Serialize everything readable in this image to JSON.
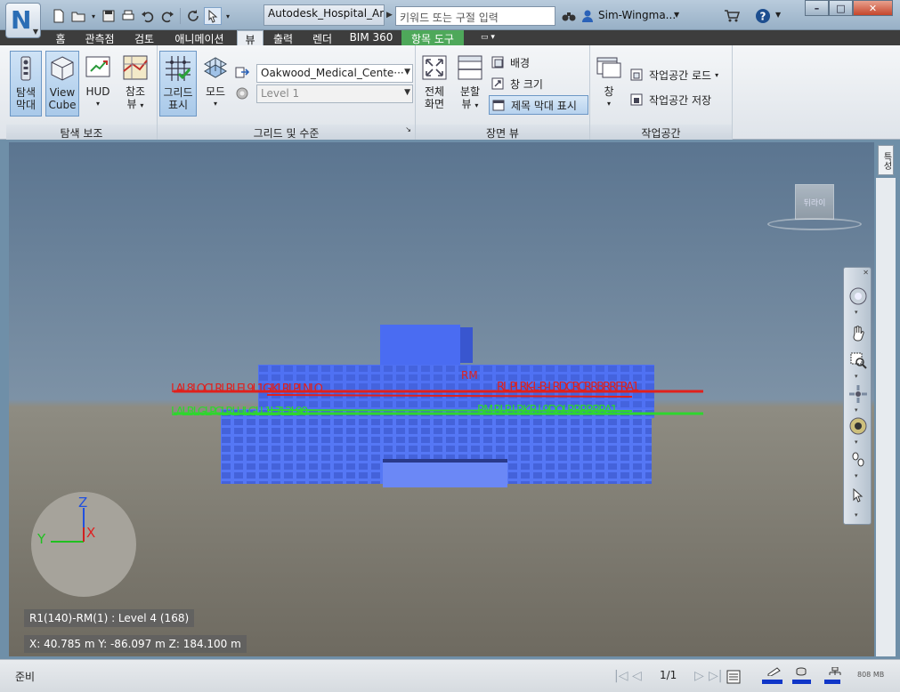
{
  "app": {
    "logo_letter": "N",
    "document_title": "Autodesk_Hospital_Ar...",
    "search_placeholder": "키워드 또는 구절 입력",
    "user_name": "Sim-Wingma...",
    "window_controls": {
      "minimize": "–",
      "maximize": "□",
      "close": "✕"
    }
  },
  "tabs": [
    {
      "label": "홈",
      "active": false
    },
    {
      "label": "관측점",
      "active": false
    },
    {
      "label": "검토",
      "active": false
    },
    {
      "label": "애니메이션",
      "active": false
    },
    {
      "label": "뷰",
      "active": true
    },
    {
      "label": "출력",
      "active": false
    },
    {
      "label": "렌더",
      "active": false
    },
    {
      "label": "BIM 360",
      "active": false
    },
    {
      "label": "항목 도구",
      "active": false,
      "contextual": true
    }
  ],
  "ribbon": {
    "nav_panel": {
      "title": "탐색 보조",
      "nav_bar_label_1": "탐색",
      "nav_bar_label_2": "막대",
      "viewcube_label_1": "View",
      "viewcube_label_2": "Cube",
      "hud_label": "HUD",
      "ref_view_label_1": "참조",
      "ref_view_label_2": "뷰"
    },
    "grid_panel": {
      "title": "그리드 및 수준",
      "show_grid_label_1": "그리드",
      "show_grid_label_2": "표시",
      "mode_label": "모드",
      "model_combo": "Oakwood_Medical_Cente···",
      "level_combo": "Level 1"
    },
    "scene_panel": {
      "title": "장면 뷰",
      "fullscreen_label_1": "전체",
      "fullscreen_label_2": "화면",
      "split_label_1": "분할",
      "split_label_2": "뷰",
      "background_label": "배경",
      "window_size_label": "창 크기",
      "title_bar_label": "제목 막대 표시"
    },
    "workspace_panel": {
      "title": "작업공간",
      "window_label": "창",
      "load_label": "작업공간 로드",
      "save_label": "작업공간 저장"
    }
  },
  "viewport": {
    "side_tab": "특성",
    "viewcube_face": "뒤라이",
    "axis_labels": {
      "z": "Z",
      "y": "Y",
      "x": "X"
    },
    "grid_labels_red_left": "LAL8LOCLRLRLEL9L1GIKLRLPLNLO",
    "grid_labels_red_right": "RL PLRK-L-B-LRDCRCRRBRRFRA1",
    "grid_labels_green_left": "LALBLGLPCLRLHLGLL1L7L2L90",
    "grid_labels_green_right": "RM RLP-LRK-B-L9DOLRRRRBRA1",
    "grid_labels_mid": "RM",
    "hud_item": "R1(140)-RM(1) : Level 4 (168)",
    "hud_coords": "X: 40.785 m  Y: -86.097 m  Z: 184.100 m"
  },
  "statusbar": {
    "status": "준비",
    "page": "1/1",
    "memory": "808 MB",
    "meters": [
      0.75,
      0.7,
      0.6
    ]
  },
  "colors": {
    "ribbon_bg": "#e3e8ee",
    "tab_bar": "#3d3d3d",
    "contextual_tab": "#4ea85a",
    "grid_red": "#e0201c",
    "grid_green": "#2ed62e",
    "building_blue": "#4d6ff0",
    "meter_blue": "#1036c8"
  }
}
